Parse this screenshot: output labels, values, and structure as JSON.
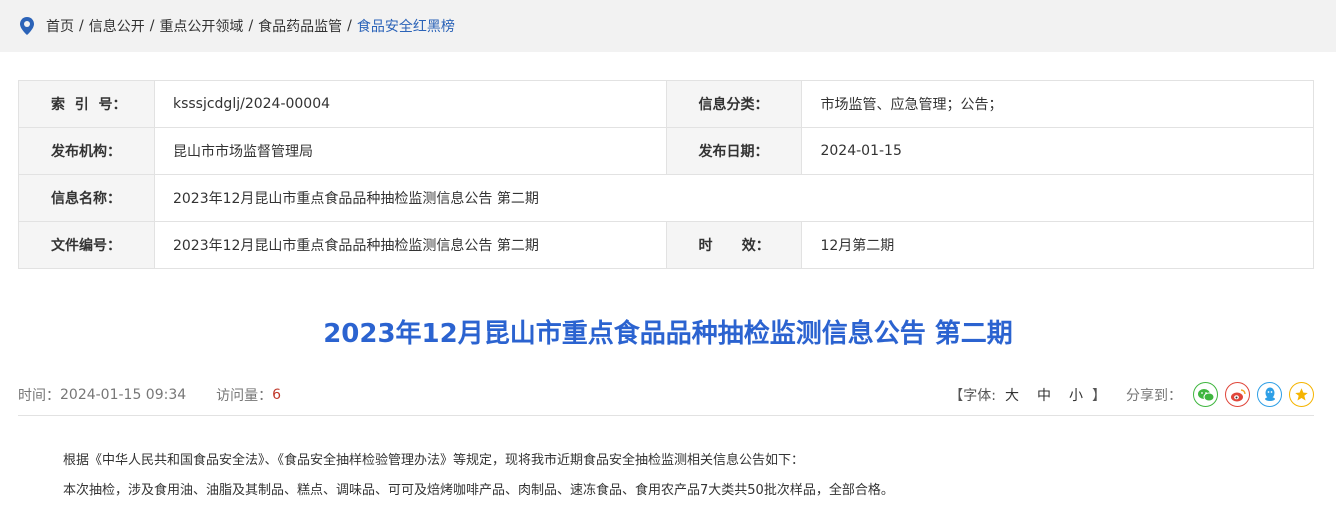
{
  "breadcrumb": {
    "items": [
      "首页",
      "信息公开",
      "重点公开领域",
      "食品药品监管"
    ],
    "current": "食品安全红黑榜",
    "separator": "/"
  },
  "meta": {
    "index_label": "索  引  号：",
    "index_value": "ksssjcdglj/2024-00004",
    "category_label": "信息分类：",
    "category_value": "市场监管、应急管理；公告；",
    "publisher_label": "发布机构：",
    "publisher_value": "昆山市市场监督管理局",
    "date_label": "发布日期：",
    "date_value": "2024-01-15",
    "name_label": "信息名称：",
    "name_value": "2023年12月昆山市重点食品品种抽检监测信息公告 第二期",
    "docno_label": "文件编号：",
    "docno_value": "2023年12月昆山市重点食品品种抽检监测信息公告 第二期",
    "validity_label": "时      效：",
    "validity_value": "12月第二期"
  },
  "article": {
    "title": "2023年12月昆山市重点食品品种抽检监测信息公告 第二期",
    "time_label": "时间：",
    "time_value": "2024-01-15 09:34",
    "views_label": "访问量：",
    "views_value": "6",
    "font_open": "【字体:",
    "font_large": "大",
    "font_medium": "中",
    "font_small": "小",
    "font_close": "】",
    "share_label": "分享到：",
    "paragraphs": [
      "根据《中华人民共和国食品安全法》、《食品安全抽样检验管理办法》等规定，现将我市近期食品安全抽检监测相关信息公告如下：",
      "本次抽检，涉及食用油、油脂及其制品、糕点、调味品、可可及焙烤咖啡产品、肉制品、速冻食品、食用农产品7大类共50批次样品，全部合格。"
    ]
  },
  "colors": {
    "accent": "#2b63d0",
    "wechat": "#3fb63f",
    "weibo": "#e0463a",
    "qq": "#2e9fe6",
    "qzone": "#f5b400"
  },
  "icons": [
    "location-pin-icon",
    "wechat-icon",
    "weibo-icon",
    "qq-icon",
    "qzone-icon"
  ]
}
